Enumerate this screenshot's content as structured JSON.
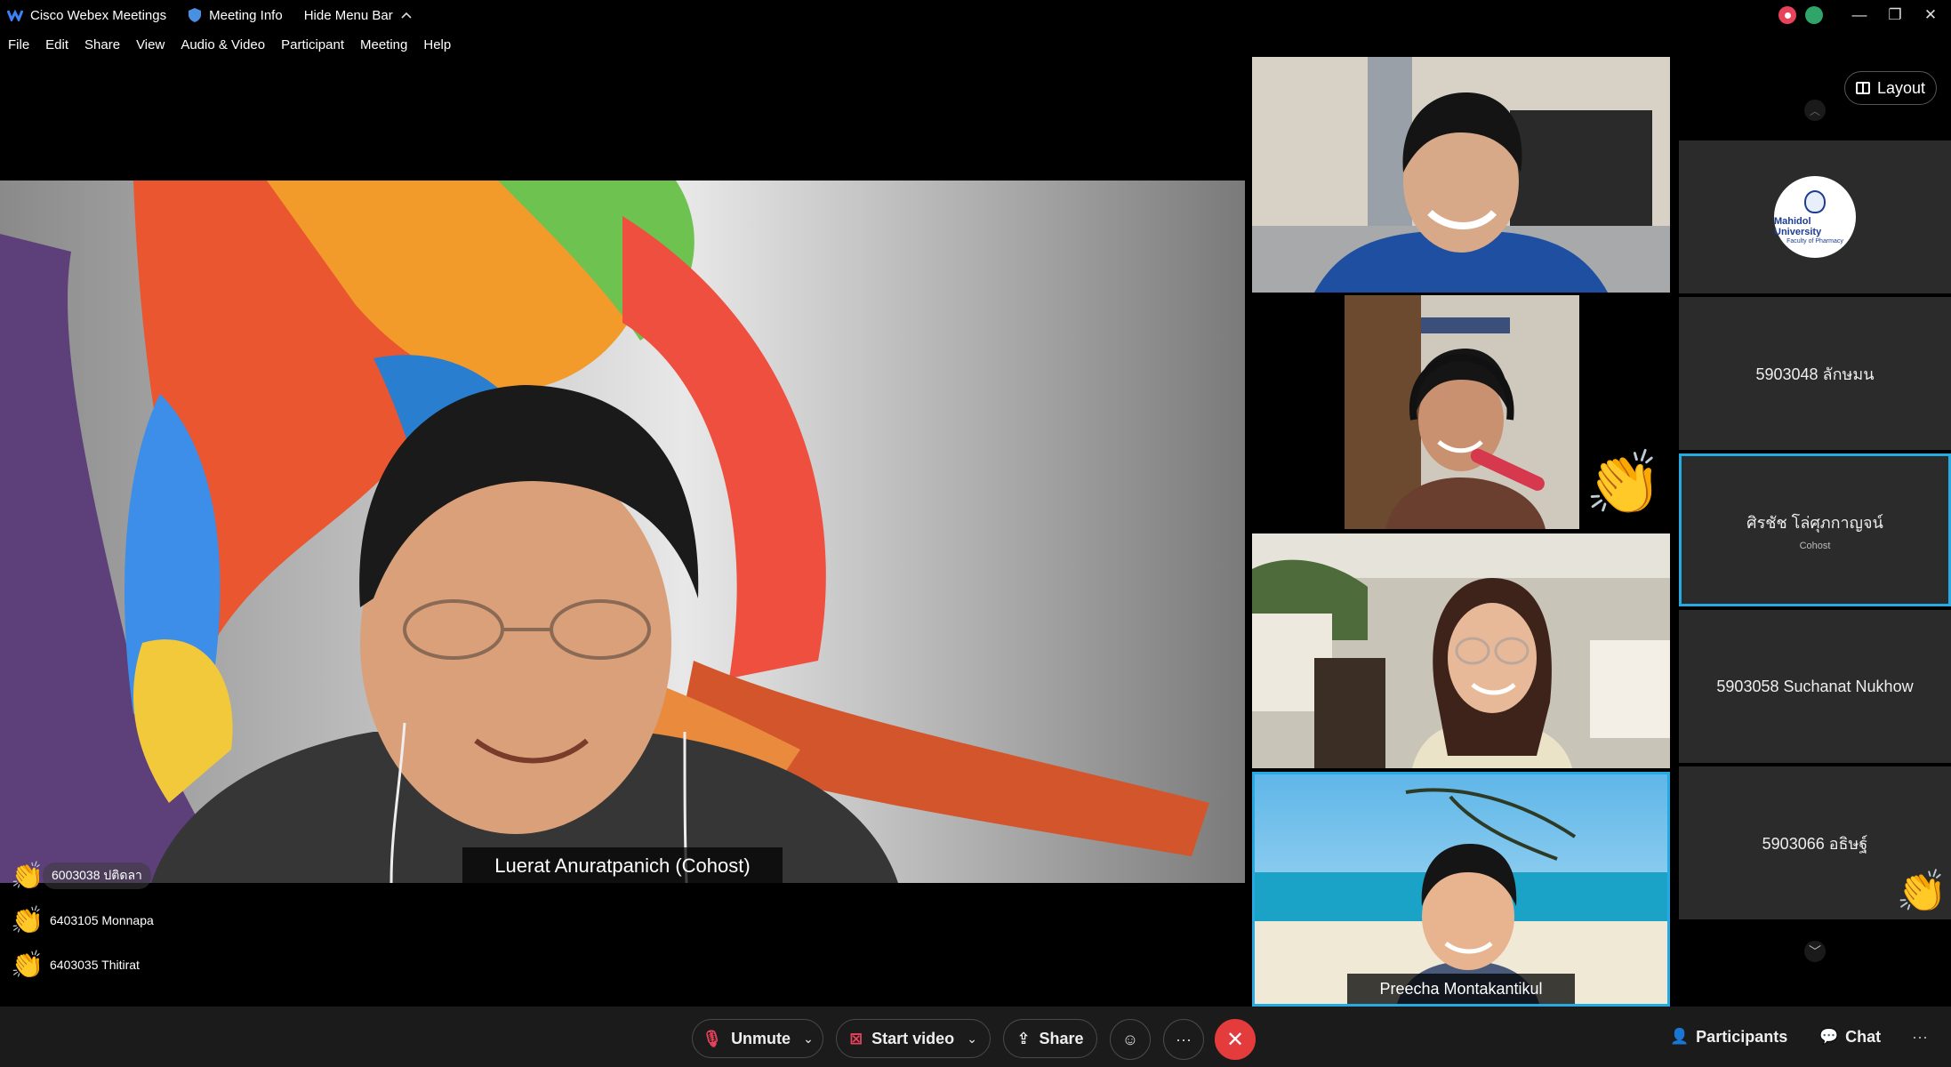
{
  "titlebar": {
    "app_name": "Cisco Webex Meetings",
    "meeting_info": "Meeting Info",
    "hide_menu_bar": "Hide Menu Bar",
    "window_buttons": [
      "—",
      "❐",
      "✕"
    ]
  },
  "menu": [
    "File",
    "Edit",
    "Share",
    "View",
    "Audio & Video",
    "Participant",
    "Meeting",
    "Help"
  ],
  "active_speaker": {
    "name": "Luerat Anuratpanich (Cohost)"
  },
  "raised_hands": [
    {
      "icon": "clapping-hands-icon",
      "label": "6003038 ปติดลา"
    },
    {
      "icon": "clapping-hands-icon",
      "label": "6403105 Monnapa"
    },
    {
      "icon": "clapping-hands-icon",
      "label": "6403035 Thitirat"
    }
  ],
  "video_tiles": [
    {
      "name": ""
    },
    {
      "name": "",
      "reaction": "clapping-hands-icon"
    },
    {
      "name": ""
    },
    {
      "name": "Preecha Montakantikul"
    }
  ],
  "layout_button": "Layout",
  "roster": [
    {
      "name": "",
      "logo_line1": "Mahidol University",
      "logo_line2": "Faculty of Pharmacy"
    },
    {
      "name": "5903048 ลักษมน"
    },
    {
      "name": "ศิรชัช โล่ศุภกาญจน์",
      "role": "Cohost"
    },
    {
      "name": "5903058 Suchanat Nukhow"
    },
    {
      "name": "5903066 อธิษฐ์",
      "reaction": "clapping-hands-icon"
    }
  ],
  "controls": {
    "unmute": "Unmute",
    "start_video": "Start video",
    "share": "Share",
    "more": "···",
    "leave": "✕",
    "participants": "Participants",
    "chat": "Chat",
    "overflow": "···"
  },
  "colors": {
    "accent_border": "#27a9e1",
    "leave_red": "#e43c3c",
    "mute_red": "#e8435a",
    "control_bar": "#1b1b1b",
    "roster_tile": "#2b2b2b"
  }
}
